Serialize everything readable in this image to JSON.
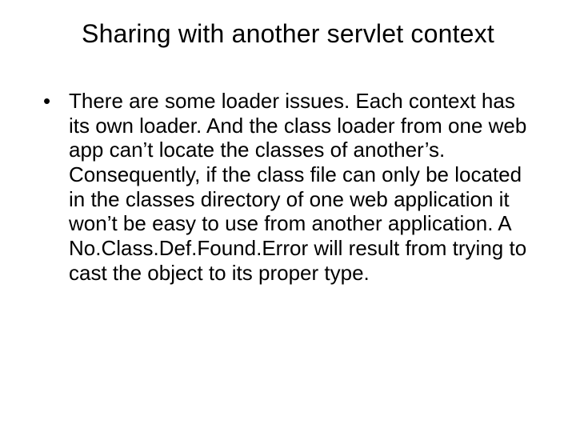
{
  "slide": {
    "title": "Sharing with another servlet context",
    "bullets": [
      "There are some loader issues.  Each context has its own loader.  And the class loader from one web app can’t locate the classes of another’s.  Consequently, if the class file can only be located in the classes directory of one web application it won’t be easy to use from another application. A No.Class.Def.Found.Error will result from trying to cast the object to its proper type."
    ]
  }
}
